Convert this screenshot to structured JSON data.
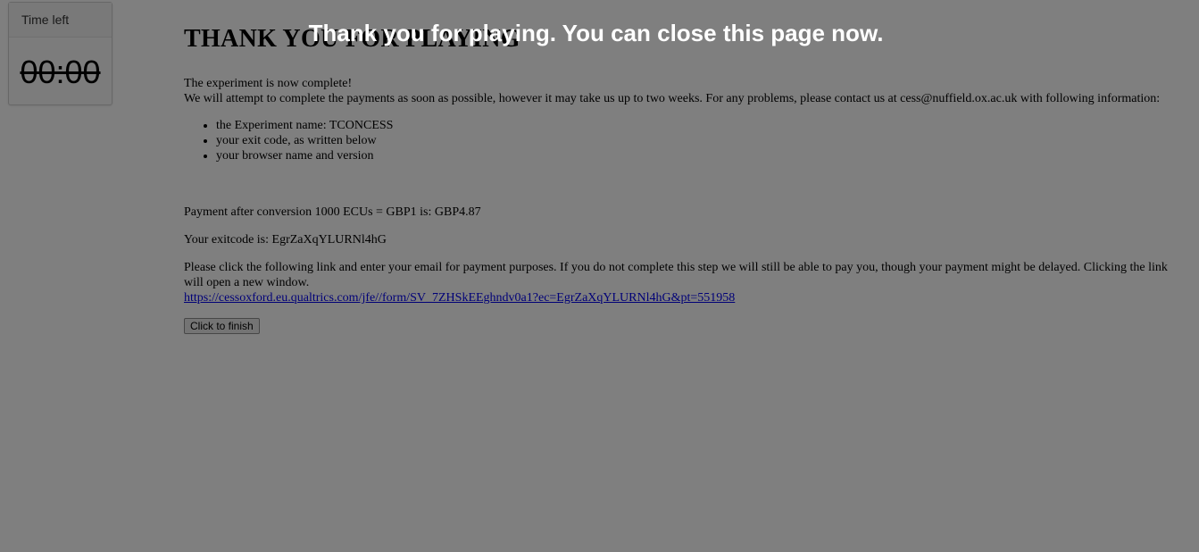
{
  "timer": {
    "label": "Time left",
    "value": "00:00"
  },
  "main": {
    "title": "THANK YOU FOR PLAYING",
    "complete_text": "The experiment is now complete!",
    "payments_text": "We will attempt to complete the payments as soon as possible, however it may take us up to two weeks. For any problems, please contact us at cess@nuffield.ox.ac.uk with following information:",
    "info_items": [
      "the Experiment name: TCONCESS",
      "your exit code, as written below",
      "your browser name and version"
    ],
    "payment_text": "Payment after conversion 1000 ECUs = GBP1 is: GBP4.87",
    "exitcode_text": "Your exitcode is: EgrZaXqYLURNl4hG",
    "email_text": "Please click the following link and enter your email for payment purposes. If you do not complete this step we will still be able to pay you, though your payment might be delayed. Clicking the link will open a new window.",
    "link_text": "https://cessoxford.eu.qualtrics.com/jfe//form/SV_7ZHSkEEghndv0a1?ec=EgrZaXqYLURNl4hG&pt=551958",
    "finish_label": "Click to finish"
  },
  "overlay": {
    "message": "Thank you for playing. You can close this page now."
  }
}
